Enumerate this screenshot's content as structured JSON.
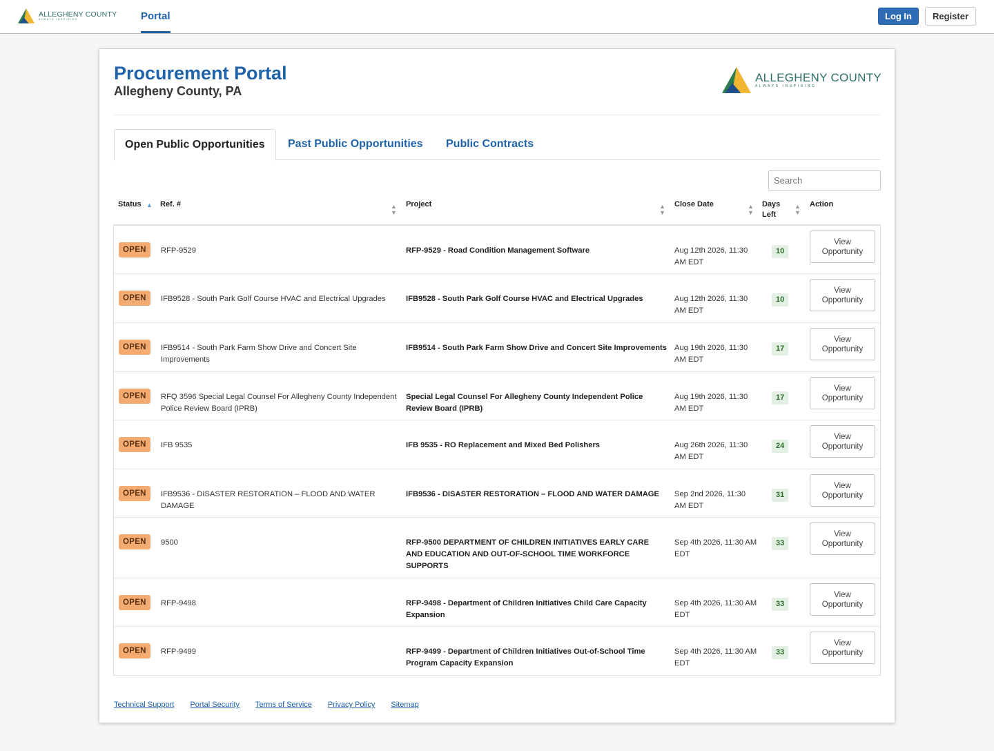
{
  "nav": {
    "logo_text": "ALLEGHENY COUNTY",
    "logo_tagline": "ALWAYS INSPIRING",
    "portal_tab": "Portal",
    "login_label": "Log In",
    "register_label": "Register"
  },
  "header": {
    "title": "Procurement Portal",
    "subtitle": "Allegheny County, PA",
    "logo_text": "ALLEGHENY COUNTY",
    "logo_tagline": "ALWAYS INSPIRING"
  },
  "tabs": [
    {
      "label": "Open Public Opportunities",
      "active": true
    },
    {
      "label": "Past Public Opportunities",
      "active": false
    },
    {
      "label": "Public Contracts",
      "active": false
    }
  ],
  "search": {
    "placeholder": "Search"
  },
  "table": {
    "columns": {
      "status": "Status",
      "ref": "Ref. #",
      "project": "Project",
      "close_date": "Close Date",
      "days_left": "Days Left",
      "action": "Action"
    },
    "rows": [
      {
        "status": "OPEN",
        "ref": "RFP-9529",
        "project": "RFP-9529 - Road Condition Management Software",
        "close_date": "Aug 12th 2026, 11:30 AM EDT",
        "days_left": "10",
        "action": "View Opportunity"
      },
      {
        "status": "OPEN",
        "ref": "IFB9528 - South Park Golf Course HVAC and Electrical Upgrades",
        "project": "IFB9528 - South Park Golf Course HVAC and Electrical Upgrades",
        "close_date": "Aug 12th 2026, 11:30 AM EDT",
        "days_left": "10",
        "action": "View Opportunity"
      },
      {
        "status": "OPEN",
        "ref": "IFB9514 - South Park Farm Show Drive and Concert Site Improvements",
        "project": "IFB9514 - South Park Farm Show Drive and Concert Site Improvements",
        "close_date": "Aug 19th 2026, 11:30 AM EDT",
        "days_left": "17",
        "action": "View Opportunity"
      },
      {
        "status": "OPEN",
        "ref": "RFQ 3596 Special Legal Counsel For Allegheny County Independent Police Review Board (IPRB)",
        "project": "Special Legal Counsel For Allegheny County Independent Police Review Board (IPRB)",
        "close_date": "Aug 19th 2026, 11:30 AM EDT",
        "days_left": "17",
        "action": "View Opportunity"
      },
      {
        "status": "OPEN",
        "ref": "IFB 9535",
        "project": "IFB 9535 - RO Replacement and Mixed Bed Polishers",
        "close_date": "Aug 26th 2026, 11:30 AM EDT",
        "days_left": "24",
        "action": "View Opportunity"
      },
      {
        "status": "OPEN",
        "ref": "IFB9536 - DISASTER RESTORATION – FLOOD AND WATER DAMAGE",
        "project": "IFB9536 - DISASTER RESTORATION – FLOOD AND WATER DAMAGE",
        "close_date": "Sep 2nd 2026, 11:30 AM EDT",
        "days_left": "31",
        "action": "View Opportunity"
      },
      {
        "status": "OPEN",
        "ref": "9500",
        "project": "RFP-9500 DEPARTMENT OF CHILDREN INITIATIVES EARLY CARE AND EDUCATION AND OUT-OF-SCHOOL TIME WORKFORCE SUPPORTS",
        "close_date": "Sep 4th 2026, 11:30 AM EDT",
        "days_left": "33",
        "action": "View Opportunity"
      },
      {
        "status": "OPEN",
        "ref": "RFP-9498",
        "project": "RFP-9498 - Department of Children Initiatives Child Care Capacity Expansion",
        "close_date": "Sep 4th 2026, 11:30 AM EDT",
        "days_left": "33",
        "action": "View Opportunity"
      },
      {
        "status": "OPEN",
        "ref": "RFP-9499",
        "project": "RFP-9499 - Department of Children Initiatives Out-of-School Time Program Capacity Expansion",
        "close_date": "Sep 4th 2026, 11:30 AM EDT",
        "days_left": "33",
        "action": "View Opportunity"
      }
    ]
  },
  "footer": {
    "links": [
      "Technical Support",
      "Portal Security",
      "Terms of Service",
      "Privacy Policy",
      "Sitemap"
    ]
  },
  "colors": {
    "brand_blue": "#1f62a8",
    "login_blue": "#2d6bb5",
    "badge_orange": "#f4ab72",
    "days_green_bg": "#e4efe4"
  }
}
